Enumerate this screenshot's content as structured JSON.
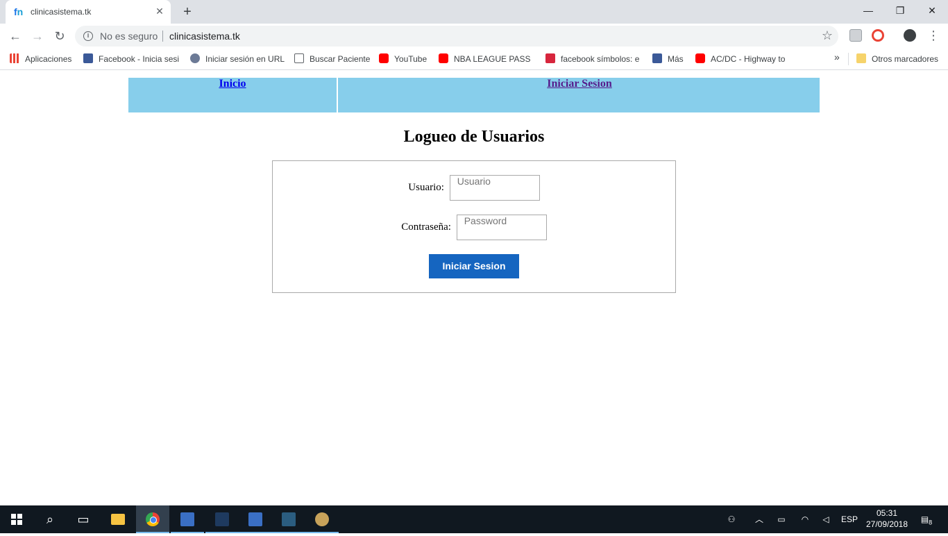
{
  "browser": {
    "tab_title": "clinicasistema.tk",
    "new_tab_icon": "+",
    "security_label": "No es seguro",
    "url": "clinicasistema.tk"
  },
  "bookmarks": [
    {
      "label": "Aplicaciones",
      "icon": "apps-icon"
    },
    {
      "label": "Facebook - Inicia sesi",
      "icon": "facebook-icon"
    },
    {
      "label": "Iniciar sesión en URL",
      "icon": "globe-icon"
    },
    {
      "label": "Buscar Paciente",
      "icon": "page-icon"
    },
    {
      "label": "YouTube",
      "icon": "youtube-icon"
    },
    {
      "label": "NBA LEAGUE PASS H",
      "icon": "youtube-icon"
    },
    {
      "label": "facebook símbolos: e",
      "icon": "flash-icon"
    },
    {
      "label": "Más",
      "icon": "facebook-icon"
    },
    {
      "label": "AC/DC - Highway to",
      "icon": "youtube-icon"
    }
  ],
  "bookmarks_more": "»",
  "other_bookmarks": "Otros marcadores",
  "page": {
    "nav": {
      "home_label": "Inicio",
      "login_label": "Iniciar Sesion"
    },
    "heading": "Logueo de Usuarios",
    "form": {
      "user_label": "Usuario:",
      "user_placeholder": "Usuario",
      "password_label": "Contraseña:",
      "password_placeholder": "Password",
      "submit_label": "Iniciar Sesion"
    },
    "colors": {
      "nav_background": "#87ceeb",
      "button_background": "#1565c0"
    }
  },
  "taskbar": {
    "language": "ESP",
    "time": "05:31",
    "date": "27/09/2018",
    "notifications_count": "8"
  }
}
